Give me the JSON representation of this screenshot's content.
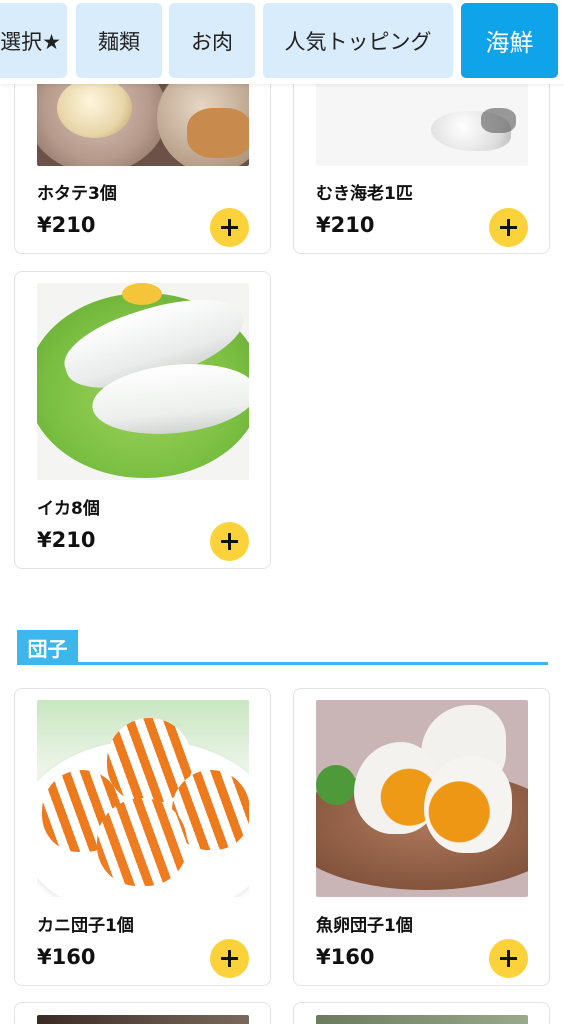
{
  "tabs": [
    {
      "label": "選択★",
      "active": false
    },
    {
      "label": "麺類",
      "active": false
    },
    {
      "label": "お肉",
      "active": false
    },
    {
      "label": "人気トッピング",
      "active": false
    },
    {
      "label": "海鮮",
      "active": true
    }
  ],
  "products": [
    {
      "name": "ホタテ3個",
      "price": "¥210",
      "image": "scallop"
    },
    {
      "name": "むき海老1匹",
      "price": "¥210",
      "image": "peeled-shrimp"
    },
    {
      "name": "イカ8個",
      "price": "¥210",
      "image": "squid"
    },
    {
      "name": "カニ団子1個",
      "price": "¥160",
      "image": "crab-dumpling"
    },
    {
      "name": "魚卵団子1個",
      "price": "¥160",
      "image": "fish-roe-dumpling"
    }
  ],
  "section": {
    "title": "団子"
  },
  "colors": {
    "tab_active": "#0fa3e9",
    "tab_inactive": "#d9ecfb",
    "section_accent": "#3db6ec",
    "add_button": "#fcd23a"
  },
  "icons": {
    "add": "plus-icon"
  }
}
